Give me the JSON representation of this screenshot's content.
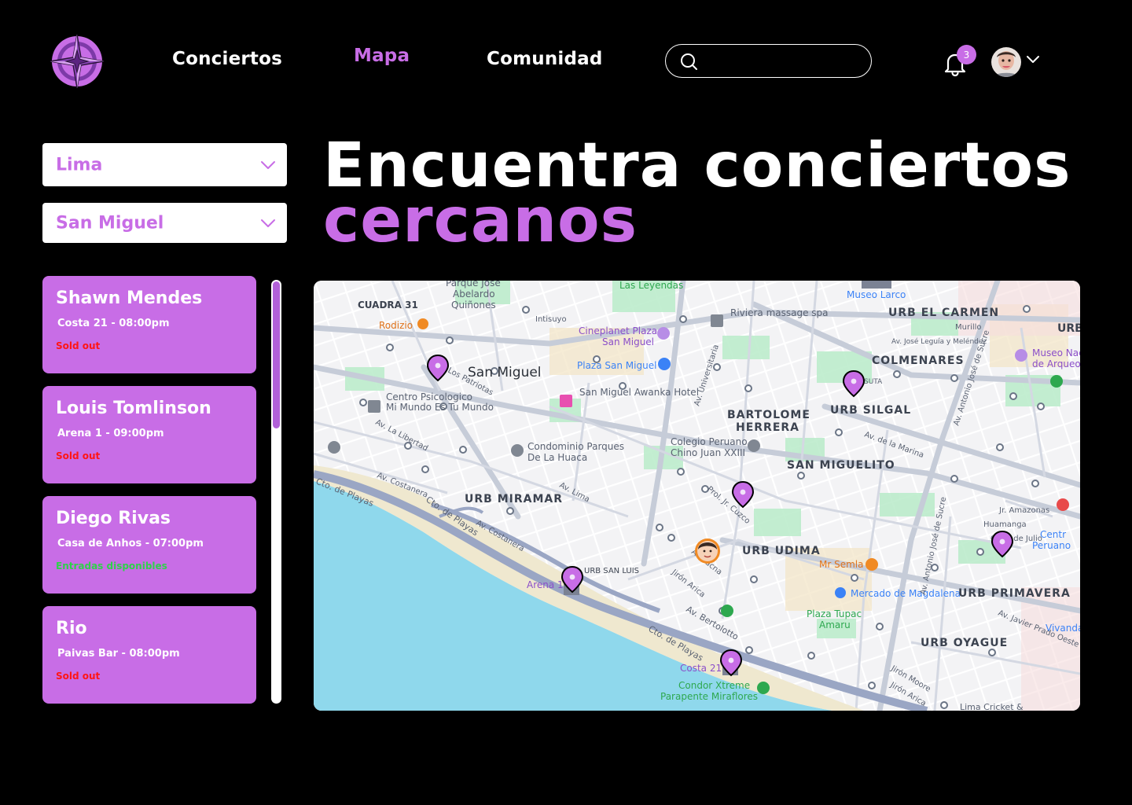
{
  "nav": {
    "items": [
      {
        "label": "Conciertos"
      },
      {
        "label": "Mapa"
      },
      {
        "label": "Comunidad"
      }
    ]
  },
  "search": {
    "placeholder": ""
  },
  "notifications": {
    "count": "3"
  },
  "filters": {
    "city": "Lima",
    "district": "San Miguel"
  },
  "hero": {
    "line1": "Encuentra conciertos",
    "line2": "cercanos"
  },
  "concerts": [
    {
      "name": "Shawn Mendes",
      "venue": "Costa 21 - 08:00pm",
      "status": "Sold out"
    },
    {
      "name": "Louis Tomlinson",
      "venue": "Arena 1 - 09:00pm",
      "status": "Sold out"
    },
    {
      "name": "Diego Rivas",
      "venue": "Casa de Anhos - 07:00pm",
      "status": "Entradas disponibles"
    },
    {
      "name": "Rio",
      "venue": "Paivas Bar - 08:00pm",
      "status": "Sold out"
    }
  ],
  "map": {
    "labels": {
      "parque": "Parque José",
      "abelardo": "Abelardo",
      "quinones": "Quiñones",
      "leyendas": "Las Leyendas",
      "museo_larco": "Museo Larco",
      "cuadra31": "CUADRA 31",
      "rodizio": "Rodizio",
      "intisuyo": "Intisuyo",
      "riviera": "Riviera massage spa",
      "carmen": "URB EL CARMEN",
      "urb": "URB",
      "cineplanet1": "Cineplanet Plaza",
      "cineplanet2": "San Miguel",
      "murillo": "Murillo",
      "leguia": "Av. José Leguía y Meléndez",
      "museo_nac1": "Museo Nac",
      "museo_nac2": "de Arqueo",
      "san_miguel": "San Miguel",
      "plaza_sm": "Plaza San Miguel",
      "colmenares": "COLMENARES",
      "patriotas": "Los Patriotas",
      "sm_hotel": "San Miguel Awanka Hotel",
      "centro1": "Centro Psicologico",
      "centro2": "Mi Mundo Es Tu Mundo",
      "suta": "SUTA",
      "silgal": "URB SILGAL",
      "bartolome": "BARTOLOME",
      "herrera": "HERRERA",
      "libertad": "Av. La Libertad",
      "condominio1": "Condominio Parques",
      "condominio2": "De La Huaca",
      "colegio1": "Colegio Peruano",
      "colegio2": "Chino Juan XXIII",
      "marina": "Av. de la Marina",
      "sanmiguelito": "SAN MIGUELITO",
      "cto_playas": "Cto. de Playas",
      "costanera": "Av. Costanera",
      "miramar": "URB MIRAMAR",
      "av_lima": "Av. Lima",
      "cuzco": "Prol. Jr. Cuzco",
      "amazonas": "Jr. Amazonas",
      "huamanga": "Huamanga",
      "julio": "C. 28 de Julio",
      "centro_peruano1": "Centr",
      "centro_peruano2": "Peruano",
      "udima": "URB UDIMA",
      "sanluis": "URB SAN LUIS",
      "arena1": "Arena 1",
      "mrsemla": "Mr Semla",
      "mercado": "Mercado de Magdalena",
      "primavera": "URB PRIMAVERA",
      "plaza_tupac1": "Plaza Tupac",
      "plaza_tupac2": "Amaru",
      "bertolotto": "Av. Bertolotto",
      "vivanda": "Vivanda",
      "javier_prado": "Av. Javier Prado Oeste",
      "oyague": "URB OYAGUE",
      "costa21": "Costa 21",
      "condor1": "Condor Xtreme",
      "condor2": "Parapente Miraflores",
      "lima_cricket": "Lima Cricket &",
      "universitaria": "Av. Universitaria",
      "sucre": "Av. Antonio José de Sucre",
      "tacna": "Av. Tacna",
      "jr_moore": "Jirón Moore",
      "jr_arica": "Jirón Arica"
    }
  },
  "colors": {
    "accent": "#c86de6",
    "sold_out": "#ff1515",
    "available": "#2fd14a",
    "map_water": "#8fd8ec"
  }
}
